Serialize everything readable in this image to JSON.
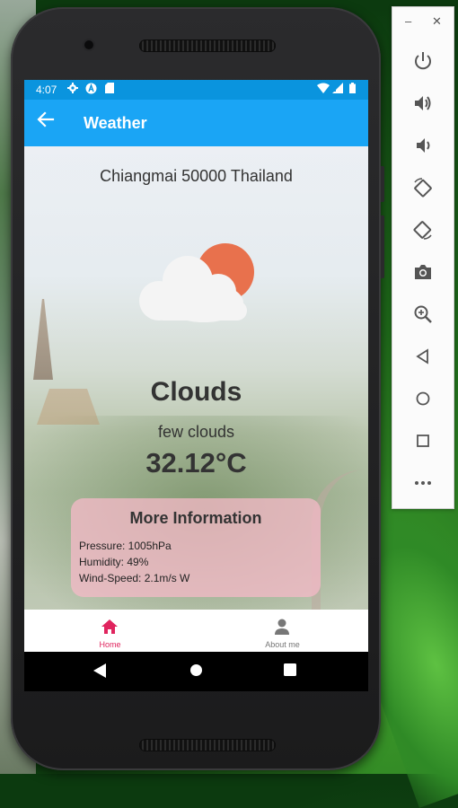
{
  "status_bar": {
    "time": "4:07",
    "icons": [
      "gear-icon",
      "a-notification-icon",
      "sd-card-icon",
      "wifi-icon",
      "signal-icon",
      "battery-icon"
    ]
  },
  "app_bar": {
    "title": "Weather",
    "back_icon": "arrow-back-icon"
  },
  "weather": {
    "location": "Chiangmai 50000 Thailand",
    "icon": "cloud-sun-icon",
    "condition": "Clouds",
    "description": "few clouds",
    "temperature": "32.12°C"
  },
  "more_info": {
    "title": "More Information",
    "pressure": "Pressure: 1005hPa",
    "humidity": "Humidity: 49%",
    "wind": "Wind-Speed: 2.1m/s W"
  },
  "bottom_nav": {
    "items": [
      {
        "label": "Home",
        "icon": "home-icon",
        "active": true
      },
      {
        "label": "About me",
        "icon": "person-icon",
        "active": false
      }
    ]
  },
  "system_nav": [
    "back-triangle-icon",
    "home-circle-icon",
    "recents-square-icon"
  ],
  "emulator_panel": {
    "window_controls": [
      "minimize-icon",
      "close-icon"
    ],
    "buttons": [
      "power-icon",
      "volume-up-icon",
      "volume-down-icon",
      "rotate-left-icon",
      "rotate-right-icon",
      "camera-icon",
      "zoom-icon",
      "back-icon",
      "home-icon",
      "overview-icon",
      "more-icon"
    ]
  },
  "colors": {
    "status_bar": "#0a94de",
    "app_bar": "#1aa5f5",
    "accent": "#e0245e",
    "card": "#f6bac8",
    "sun": "#e8714d"
  }
}
